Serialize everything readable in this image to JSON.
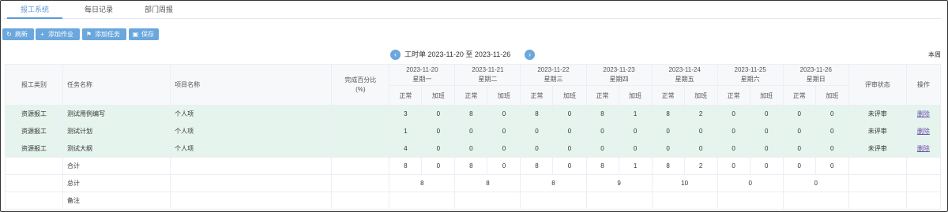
{
  "tabs": [
    "报工系统",
    "每日记录",
    "部门周报"
  ],
  "toolbar": {
    "refresh": "刷新",
    "add_work": "添加作业",
    "add_task": "添加任务",
    "save": "保存"
  },
  "nav": {
    "title": "工时单 2023-11-20 至 2023-11-26",
    "this_week": "本周"
  },
  "headers": {
    "category": "报工类别",
    "task": "任务名称",
    "project": "项目名称",
    "completion_line1": "完成百分比",
    "completion_line2": "(%)",
    "review": "评审状态",
    "action": "操作",
    "normal": "正常",
    "overtime": "加班"
  },
  "days": [
    {
      "date": "2023-11-20",
      "weekday": "星期一"
    },
    {
      "date": "2023-11-21",
      "weekday": "星期二"
    },
    {
      "date": "2023-11-22",
      "weekday": "星期三"
    },
    {
      "date": "2023-11-23",
      "weekday": "星期四"
    },
    {
      "date": "2023-11-24",
      "weekday": "星期五"
    },
    {
      "date": "2023-11-25",
      "weekday": "星期六"
    },
    {
      "date": "2023-11-26",
      "weekday": "星期日"
    }
  ],
  "rows": [
    {
      "category": "资源报工",
      "task": "测试用例编写",
      "project": "个人项",
      "hours": [
        3,
        0,
        8,
        0,
        8,
        0,
        8,
        1,
        8,
        2,
        0,
        0,
        0,
        0
      ],
      "review": "未评审",
      "action": "删除"
    },
    {
      "category": "资源报工",
      "task": "测试计划",
      "project": "个人项",
      "hours": [
        1,
        0,
        0,
        0,
        0,
        0,
        0,
        0,
        0,
        0,
        0,
        0,
        0,
        0
      ],
      "review": "未评审",
      "action": "删除"
    },
    {
      "category": "资源报工",
      "task": "测试大纲",
      "project": "个人项",
      "hours": [
        4,
        0,
        0,
        0,
        0,
        0,
        0,
        0,
        0,
        0,
        0,
        0,
        0,
        0
      ],
      "review": "未评审",
      "action": "删除"
    }
  ],
  "subtotal": {
    "label": "合计",
    "hours": [
      8,
      0,
      8,
      0,
      8,
      0,
      8,
      1,
      8,
      2,
      0,
      0,
      0,
      0
    ]
  },
  "total": {
    "label": "总计",
    "values": [
      8,
      8,
      8,
      9,
      10,
      0,
      0
    ]
  },
  "note": {
    "label": "备注"
  },
  "colors": {
    "accent": "#6aa7dc",
    "row_highlight": "#e6f4ee",
    "delete_link": "#6a4fa8"
  }
}
